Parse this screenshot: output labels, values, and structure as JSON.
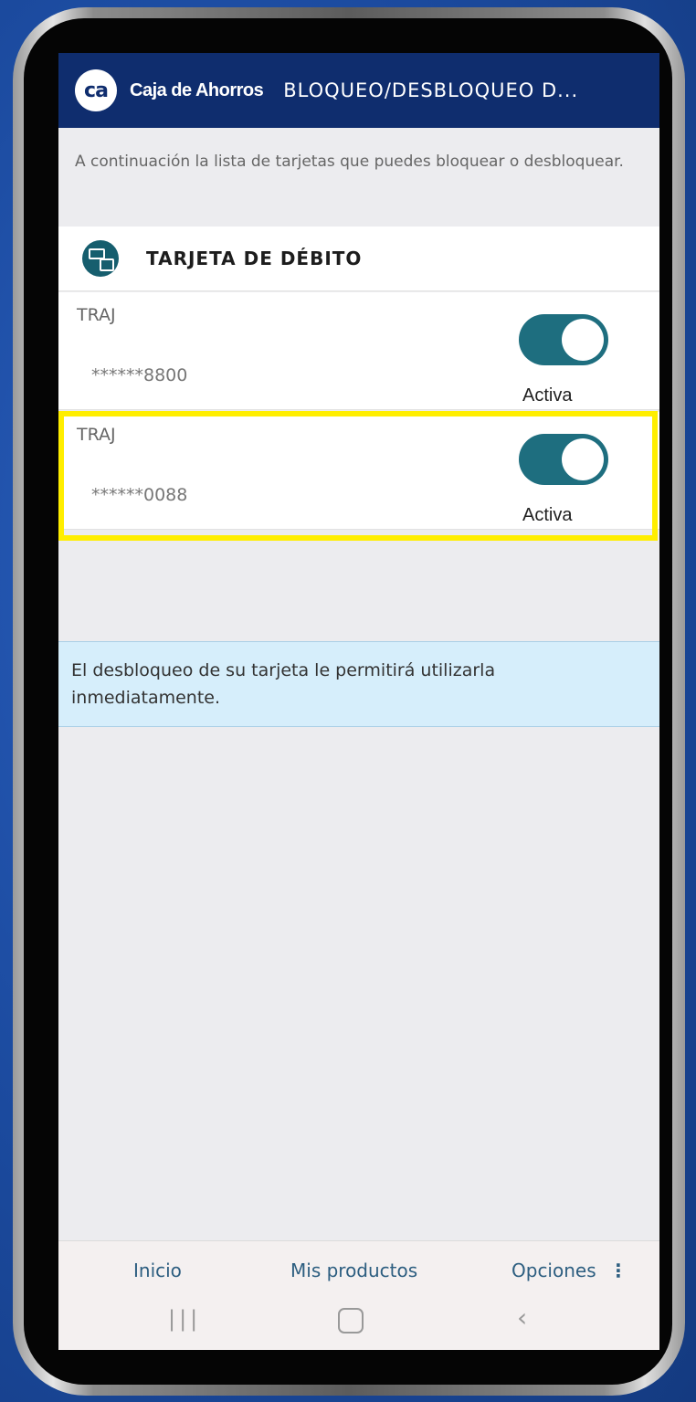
{
  "header": {
    "logo_text": "ca",
    "brand": "Caja de Ahorros",
    "title": "BLOQUEO/DESBLOQUEO D..."
  },
  "intro": "A continuación la lista de tarjetas que puedes bloquear o desbloquear.",
  "section": {
    "icon": "card-lock-icon",
    "title": "TARJETA DE DÉBITO"
  },
  "cards": [
    {
      "name": "TRAJ",
      "number": "******8800",
      "status": "Activa",
      "toggle_on": true
    },
    {
      "name": "TRAJ",
      "number": "******0088",
      "status": "Activa",
      "toggle_on": true
    }
  ],
  "info": "El desbloqueo de su tarjeta le permitirá utilizarla inmediatamente.",
  "bottom_nav": {
    "inicio": "Inicio",
    "mis_productos": "Mis productos",
    "opciones": "Opciones",
    "more_glyph": "⋮"
  },
  "system_nav": {
    "recent_glyph": "|||",
    "back_glyph": "‹"
  },
  "colors": {
    "header_bg": "#0f2d6e",
    "toggle_on": "#1e6e7f",
    "highlight": "#ffee00",
    "info_bg": "#d6eefb",
    "nav_text": "#2d5e80"
  }
}
